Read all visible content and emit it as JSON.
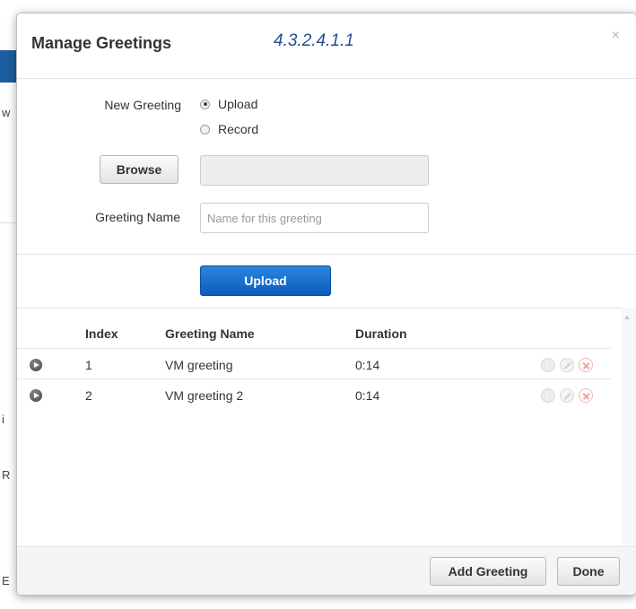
{
  "background": {
    "fragments": [
      "w",
      "i",
      "R",
      "E"
    ]
  },
  "modal": {
    "title": "Manage Greetings",
    "version": "4.3.2.4.1.1",
    "close": "×"
  },
  "form": {
    "new_greeting_label": "New Greeting",
    "options": [
      "Upload",
      "Record"
    ],
    "selected": "Upload",
    "browse_label": "Browse",
    "file_value": "",
    "greeting_name_label": "Greeting Name",
    "greeting_name_placeholder": "Name for this greeting",
    "greeting_name_value": "",
    "upload_button": "Upload"
  },
  "table": {
    "columns": [
      "Index",
      "Greeting Name",
      "Duration"
    ],
    "rows": [
      {
        "index": "1",
        "name": "VM greeting",
        "duration": "0:14"
      },
      {
        "index": "2",
        "name": "VM greeting 2",
        "duration": "0:14"
      }
    ],
    "icons": [
      "play-icon",
      "download-icon",
      "edit-icon",
      "delete-icon"
    ]
  },
  "footer": {
    "add_greeting": "Add Greeting",
    "done": "Done"
  },
  "colors": {
    "primary": "#0b5cc0",
    "title_accent": "#2a4c8c",
    "delete": "#f3a0a0"
  }
}
